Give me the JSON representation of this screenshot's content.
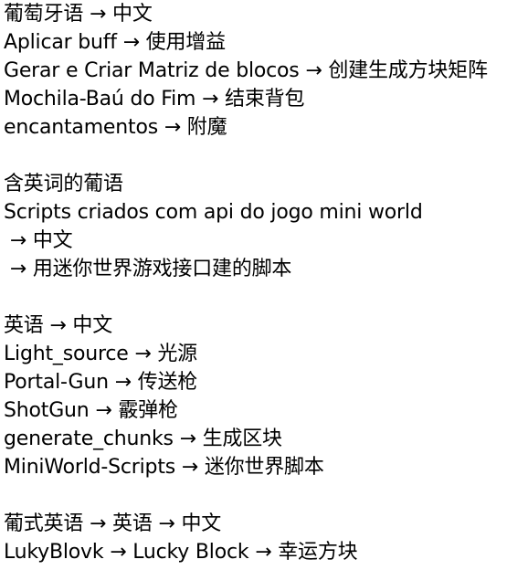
{
  "lines": [
    "葡萄牙语 → 中文",
    "Aplicar buff → 使用增益",
    "Gerar e Criar Matriz de blocos → 创建生成方块矩阵",
    "Mochila-Baú do Fim → 结束背包",
    "encantamentos → 附魔",
    "",
    "含英词的葡语",
    "Scripts criados com api do jogo mini world",
    " → 中文",
    " → 用迷你世界游戏接口建的脚本",
    "",
    "英语 → 中文",
    "Light_source → 光源",
    "Portal-Gun → 传送枪",
    "ShotGun → 霰弹枪",
    "generate_chunks → 生成区块",
    "MiniWorld-Scripts → 迷你世界脚本",
    "",
    "葡式英语 → 英语 → 中文",
    "LukyBlovk → Lucky Block → 幸运方块"
  ]
}
